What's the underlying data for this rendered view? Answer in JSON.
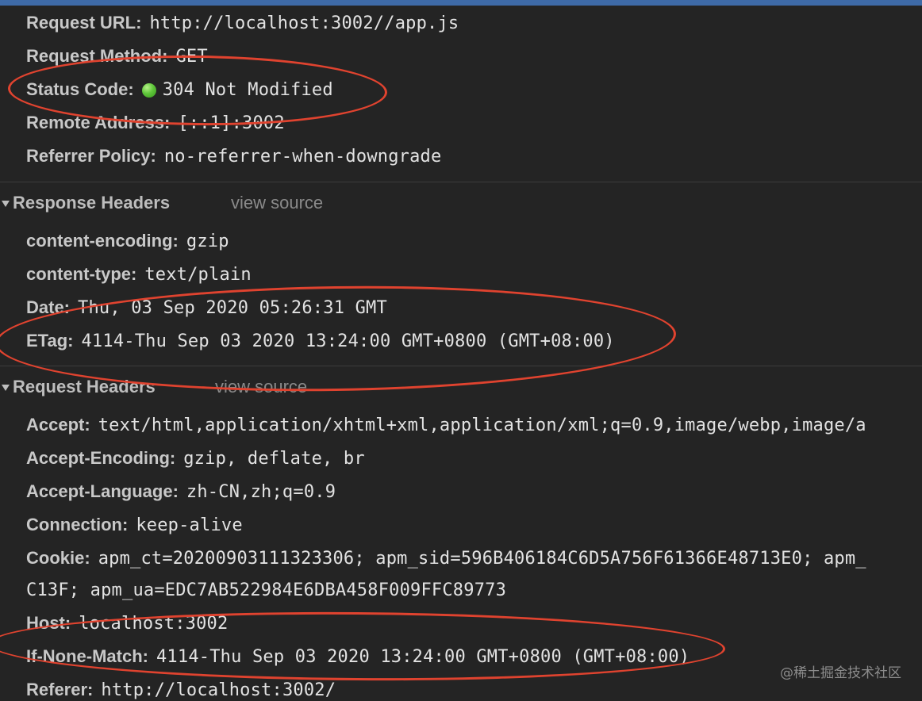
{
  "general": [
    {
      "key": "Request URL:",
      "value": "http://localhost:3002//app.js"
    },
    {
      "key": "Request Method:",
      "value": "GET"
    },
    {
      "key": "Status Code:",
      "value": "304 Not Modified",
      "status_color": "#5fc63a"
    },
    {
      "key": "Remote Address:",
      "value": "[::1]:3002"
    },
    {
      "key": "Referrer Policy:",
      "value": "no-referrer-when-downgrade"
    }
  ],
  "response_section": {
    "title": "Response Headers",
    "view_source": "view source"
  },
  "response_headers": [
    {
      "key": "content-encoding:",
      "value": "gzip"
    },
    {
      "key": "content-type:",
      "value": "text/plain"
    },
    {
      "key": "Date:",
      "value": "Thu, 03 Sep 2020 05:26:31 GMT"
    },
    {
      "key": "ETag:",
      "value": "4114-Thu Sep 03 2020 13:24:00 GMT+0800 (GMT+08:00)"
    }
  ],
  "request_section": {
    "title": "Request Headers",
    "view_source": "view source"
  },
  "request_headers": [
    {
      "key": "Accept:",
      "value": "text/html,application/xhtml+xml,application/xml;q=0.9,image/webp,image/a"
    },
    {
      "key": "Accept-Encoding:",
      "value": "gzip, deflate, br"
    },
    {
      "key": "Accept-Language:",
      "value": "zh-CN,zh;q=0.9"
    },
    {
      "key": "Connection:",
      "value": "keep-alive"
    },
    {
      "key": "Cookie:",
      "value": "apm_ct=20200903111323306; apm_sid=596B406184C6D5A756F61366E48713E0; apm_"
    },
    {
      "key": "",
      "value": "C13F; apm_ua=EDC7AB522984E6DBA458F009FFC89773"
    },
    {
      "key": "Host:",
      "value": "localhost:3002"
    },
    {
      "key": "If-None-Match:",
      "value": "4114-Thu Sep 03 2020 13:24:00 GMT+0800 (GMT+08:00)"
    },
    {
      "key": "Referer:",
      "value": "http://localhost:3002/"
    }
  ],
  "watermark": "@稀土掘金技术社区",
  "colors": {
    "annotation": "#e0432f",
    "background": "#242424",
    "accent_bar": "#3e6aa7"
  }
}
